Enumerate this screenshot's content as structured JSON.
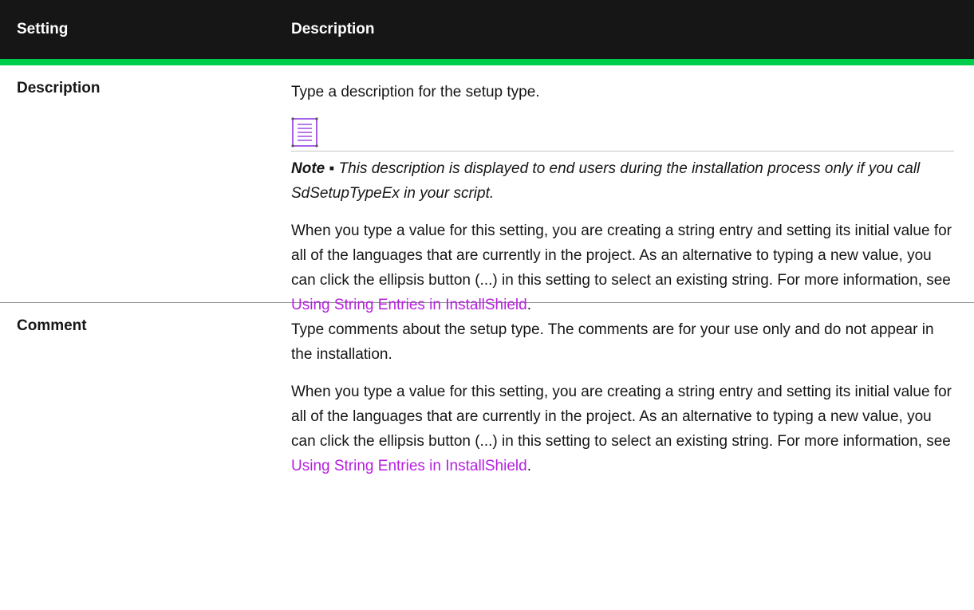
{
  "header": {
    "setting_label": "Setting",
    "description_label": "Description"
  },
  "rows": [
    {
      "setting": "Description",
      "intro": "Type a description for the setup type.",
      "note": {
        "icon": "note-document-icon",
        "label": "Note",
        "bullet": "▪",
        "text": "This description is displayed to end users during the installation process only if you call SdSetupTypeEx in your script."
      },
      "body_prefix": "When you type a value for this setting, you are creating a string entry and setting its initial value for all of the languages that are currently in the project. As an alternative to typing a new value, you can click the ellipsis button (...) in this setting to select an existing string. For more information, see ",
      "link_text": "Using String Entries in InstallShield",
      "body_suffix": "."
    },
    {
      "setting": "Comment",
      "intro": "Type comments about the setup type. The comments are for your use only and do not appear in the installation.",
      "body_prefix": "When you type a value for this setting, you are creating a string entry and setting its initial value for all of the languages that are currently in the project. As an alternative to typing a new value, you can click the ellipsis button (...) in this setting to select an existing string. For more information, see ",
      "link_text": "Using String Entries in InstallShield",
      "body_suffix": "."
    }
  ],
  "colors": {
    "header_bg": "#161616",
    "header_accent": "#00ce4b",
    "link": "#b620e0",
    "icon": "#8a2be2"
  }
}
